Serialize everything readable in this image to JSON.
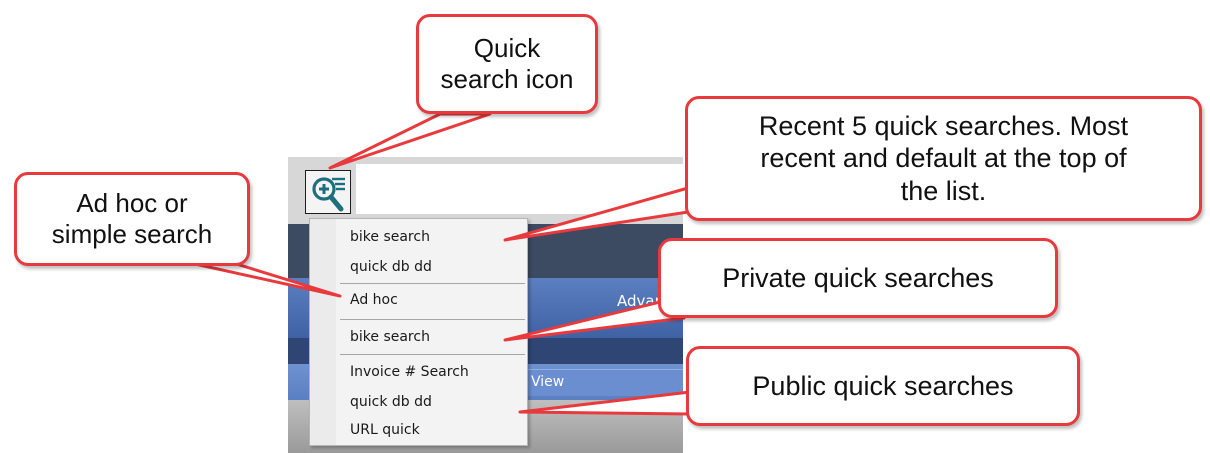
{
  "app": {
    "advanced_label": "Advan",
    "view_label": "View"
  },
  "quick_search": {
    "icon": "zoom-in-list-icon",
    "recent": [
      "bike search",
      "quick db dd"
    ],
    "ad_hoc": "Ad hoc",
    "private": [
      "bike search"
    ],
    "public": [
      "Invoice # Search",
      "quick db dd",
      "URL quick"
    ]
  },
  "callouts": {
    "icon": "Quick\nsearch icon",
    "recent": "Recent 5 quick searches. Most\nrecent and default at the top of\nthe list.",
    "ad_hoc": "Ad hoc or\nsimple search",
    "private": "Private quick searches",
    "public": "Public quick searches"
  },
  "colors": {
    "callout_border": "#e83a3d",
    "icon_teal": "#1e6f7e"
  }
}
